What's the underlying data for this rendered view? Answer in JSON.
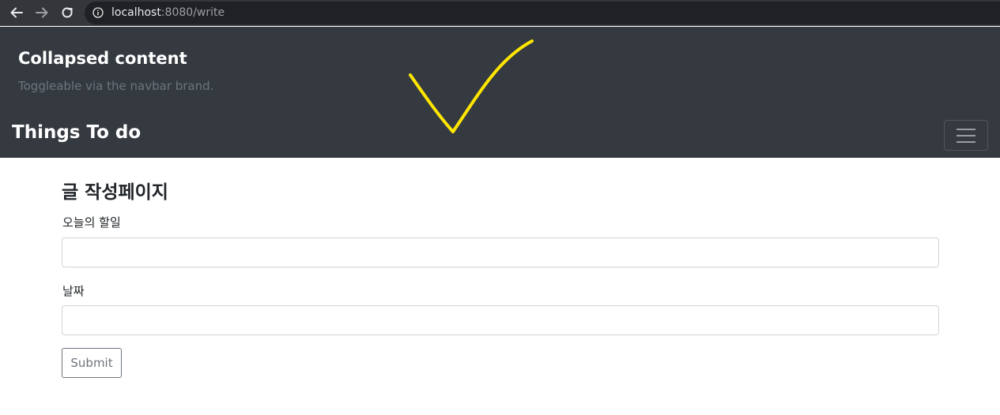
{
  "browser": {
    "url_host": "localhost",
    "url_rest": ":8080/write"
  },
  "navbar": {
    "collapse_title": "Collapsed content",
    "collapse_subtitle": "Toggleable via the navbar brand.",
    "brand": "Things To do",
    "toggler_icon": "hamburger-icon",
    "background_color": "#343a40"
  },
  "annotation": {
    "checkmark_color": "#ffe600"
  },
  "form": {
    "title": "글 작성페이지",
    "todo_label": "오늘의 할일",
    "todo_value": "",
    "date_label": "날짜",
    "date_value": "",
    "submit_label": "Submit"
  }
}
